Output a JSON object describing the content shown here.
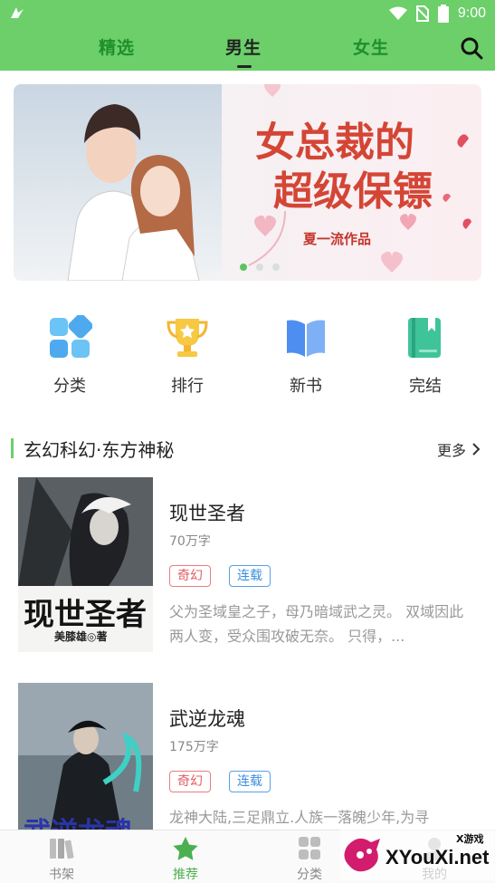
{
  "status": {
    "time": "9:00"
  },
  "nav": {
    "tabs": [
      "精选",
      "男生",
      "女生"
    ],
    "active_tab": "男生"
  },
  "banner": {
    "title_line1": "女总裁的",
    "title_line2": "超级保镖",
    "author": "夏一流作品",
    "page_index": 1,
    "page_count": 3
  },
  "entries": [
    {
      "label": "分类",
      "icon": "category-grid-icon"
    },
    {
      "label": "排行",
      "icon": "trophy-icon"
    },
    {
      "label": "新书",
      "icon": "open-book-icon"
    },
    {
      "label": "完结",
      "icon": "bookmark-book-icon"
    }
  ],
  "section": {
    "title": "玄幻科幻·东方神秘",
    "more": "更多"
  },
  "books": [
    {
      "name": "现世圣者",
      "words": "70万字",
      "tags": [
        "奇幻",
        "连载"
      ],
      "desc": "父为圣域皇之子，母乃暗域武之灵。 双域因此两人变，受众围攻破无奈。 只得，...",
      "cover_text": "现世圣者",
      "cover_author": "美膝雄◎著"
    },
    {
      "name": "武逆龙魂",
      "words": "175万字",
      "tags": [
        "奇幻",
        "连载"
      ],
      "desc": "龙神大陆,三足鼎立.人族一落魄少年,为寻",
      "cover_text": "武逆龙魂"
    }
  ],
  "bottom_nav": [
    {
      "label": "书架",
      "icon": "bookshelf-icon"
    },
    {
      "label": "推荐",
      "icon": "star-icon"
    },
    {
      "label": "分类",
      "icon": "grid-icon"
    },
    {
      "label": "我的",
      "icon": "user-icon"
    }
  ],
  "watermark": {
    "text": "XYouXi.net",
    "small": "X游戏"
  },
  "colors": {
    "accent": "#6ccf6a",
    "tag_red": "#e35b63",
    "tag_blue": "#3a8ee0"
  }
}
